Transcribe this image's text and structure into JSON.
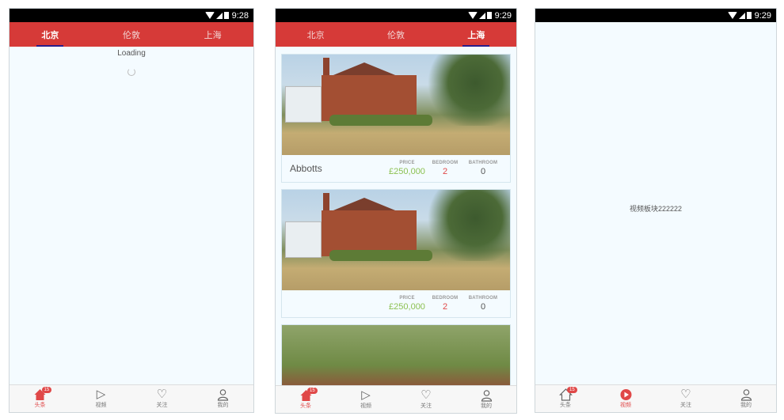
{
  "screens": [
    {
      "time": "9:28",
      "tabs": [
        "北京",
        "伦敦",
        "上海"
      ],
      "active_tab": 0,
      "loading_text": "Loading"
    },
    {
      "time": "9:29",
      "tabs": [
        "北京",
        "伦敦",
        "上海"
      ],
      "active_tab": 2,
      "listings": [
        {
          "name": "Abbotts",
          "price_label": "PRICE",
          "price": "£250,000",
          "bedroom_label": "BEDROOM",
          "bedroom": "2",
          "bathroom_label": "BATHROOM",
          "bathroom": "0"
        },
        {
          "name": "",
          "price_label": "PRICE",
          "price": "£250,000",
          "bedroom_label": "BEDROOM",
          "bedroom": "2",
          "bathroom_label": "BATHROOM",
          "bathroom": "0"
        }
      ]
    },
    {
      "time": "9:29",
      "video_text": "视频板块222222"
    }
  ],
  "bottom_nav": {
    "items": [
      "头条",
      "视频",
      "关注",
      "我的"
    ],
    "badge": "15"
  },
  "colors": {
    "accent": "#d63a38",
    "price": "#8cc152",
    "bedroom": "#e04848",
    "tab_indicator": "#2a1d8a"
  }
}
